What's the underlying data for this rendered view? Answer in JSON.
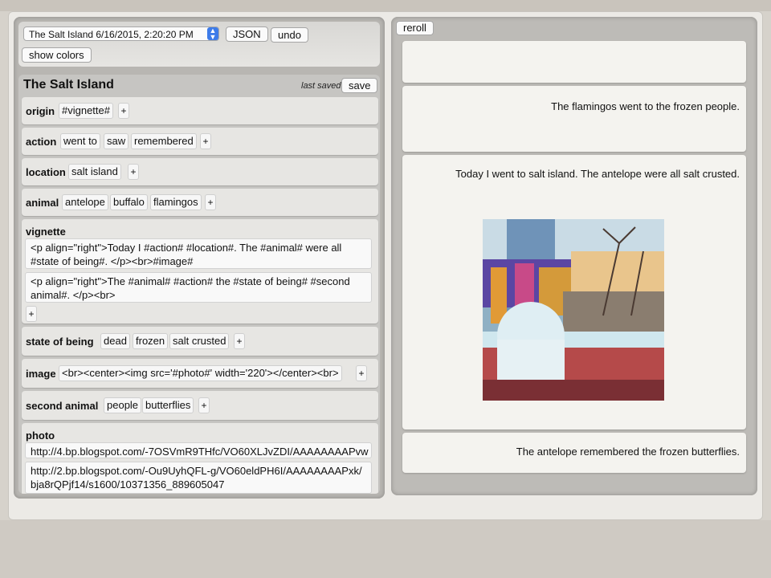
{
  "toolbar": {
    "grammar_select_value": "The Salt Island 6/16/2015, 2:20:20 PM",
    "json_label": "JSON",
    "undo_label": "undo",
    "show_colors_label": "show colors"
  },
  "editor": {
    "title": "The Salt Island",
    "last_saved_label": "last saved",
    "save_label": "save",
    "plus_label": "+",
    "rules": {
      "origin": {
        "name": "origin",
        "values": [
          "#vignette#"
        ]
      },
      "action": {
        "name": "action",
        "values": [
          "went to",
          "saw",
          "remembered"
        ]
      },
      "location": {
        "name": "location",
        "values": [
          "salt island"
        ]
      },
      "animal": {
        "name": "animal",
        "values": [
          "antelope",
          "buffalo",
          "flamingos"
        ]
      },
      "vignette": {
        "name": "vignette",
        "values": [
          "<p align=\"right\">Today I #action# #location#. The #animal# were all #state of being#. </p><br>#image#",
          "<p align=\"right\">The #animal# #action# the #state of being# #second animal#. </p><br>"
        ]
      },
      "state_of_being": {
        "name": "state of being",
        "values": [
          "dead",
          "frozen",
          "salt crusted"
        ]
      },
      "image": {
        "name": "image",
        "values": [
          "<br><center><img src='#photo#' width='220'></center><br>"
        ]
      },
      "second_animal": {
        "name": "second animal",
        "values": [
          "people",
          "butterflies"
        ]
      },
      "photo": {
        "name": "photo",
        "values": [
          "http://4.bp.blogspot.com/-7OSVmR9THfc/VO60XLJvZDI/AAAAAAAAPvw",
          "http://2.bp.blogspot.com/-Ou9UyhQFL-g/VO60eldPH6I/AAAAAAAAPxk/bja8rQPjf14/s1600/10371356_889605047"
        ]
      }
    }
  },
  "output": {
    "reroll_label": "reroll",
    "cards": [
      {
        "text": ""
      },
      {
        "text": "The flamingos went to the frozen people."
      },
      {
        "text": "Today I went to salt island. The antelope were all salt crusted."
      },
      {
        "text": "The antelope remembered the frozen butterflies."
      }
    ]
  }
}
